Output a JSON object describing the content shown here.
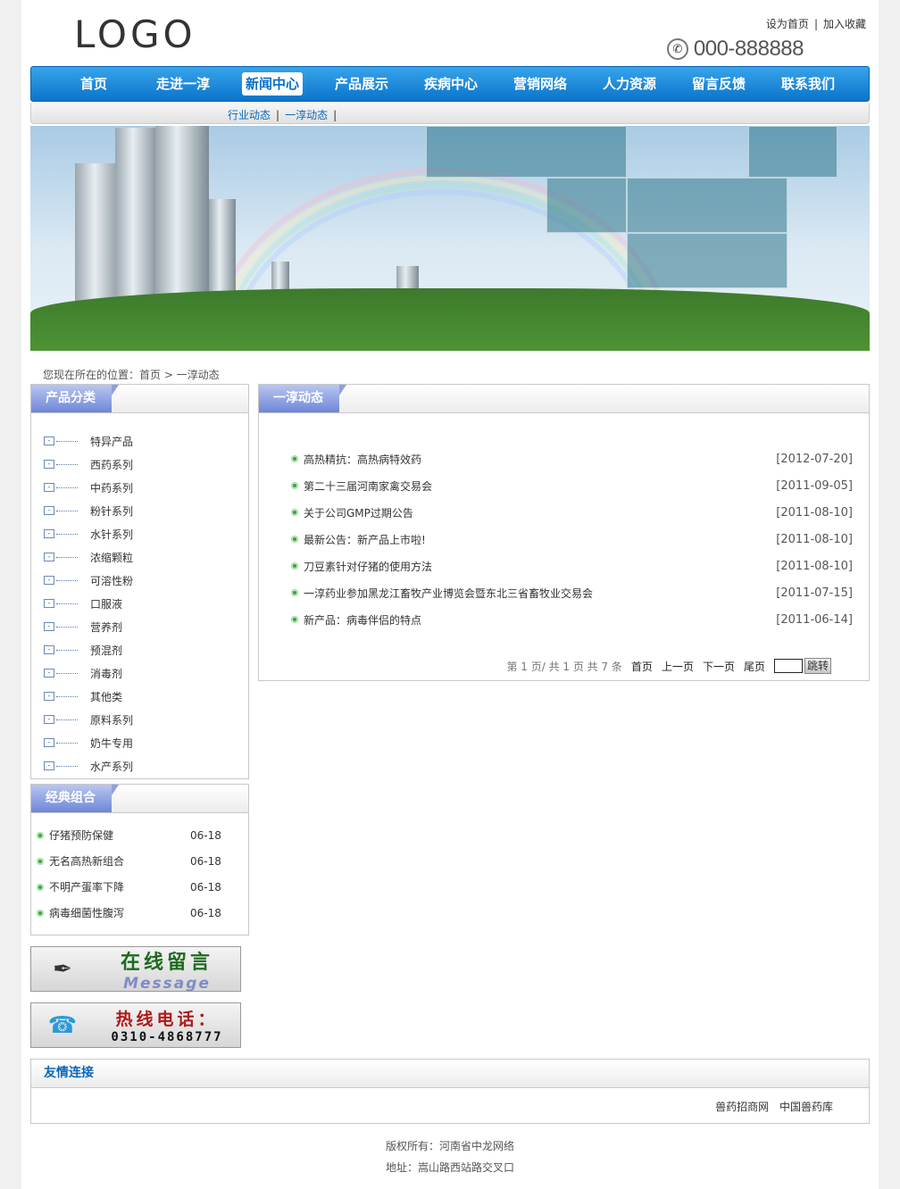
{
  "header": {
    "logo": "LOGO",
    "set_home": "设为首页",
    "sep": "|",
    "add_favorite": "加入收藏",
    "phone": "000-888888"
  },
  "nav": {
    "items": [
      "首页",
      "走进一淳",
      "新闻中心",
      "产品展示",
      "疾病中心",
      "营销网络",
      "人力资源",
      "留言反馈",
      "联系我们"
    ],
    "active_index": 2
  },
  "subnav": {
    "items": [
      "行业动态",
      "一淳动态"
    ]
  },
  "breadcrumb": "您现在所在的位置：首页 > 一淳动态",
  "categories": {
    "title": "产品分类",
    "items": [
      "特异产品",
      "西药系列",
      "中药系列",
      "粉针系列",
      "水针系列",
      "浓缩颗粒",
      "可溶性粉",
      "口服液",
      "营养剂",
      "预混剂",
      "消毒剂",
      "其他类",
      "原料系列",
      "奶牛专用",
      "水产系列"
    ]
  },
  "combos": {
    "title": "经典组合",
    "items": [
      {
        "title": "仔猪预防保健",
        "date": "06-18"
      },
      {
        "title": "无名高热新组合",
        "date": "06-18"
      },
      {
        "title": "不明产蛋率下降",
        "date": "06-18"
      },
      {
        "title": "病毒细菌性腹泻",
        "date": "06-18"
      }
    ]
  },
  "badges": {
    "message_cn": "在线留言",
    "message_en": "Message",
    "hotline_cn": "热线电话：",
    "hotline_num": "0310-4868777"
  },
  "main": {
    "title": "一淳动态",
    "news": [
      {
        "title": "高热精抗：高热病特效药",
        "date": "[2012-07-20]"
      },
      {
        "title": "第二十三届河南家禽交易会",
        "date": "[2011-09-05]"
      },
      {
        "title": "关于公司GMP过期公告",
        "date": "[2011-08-10]"
      },
      {
        "title": "最新公告：新产品上市啦!",
        "date": "[2011-08-10]"
      },
      {
        "title": "刀豆素针对仔猪的使用方法",
        "date": "[2011-08-10]"
      },
      {
        "title": "一淳药业参加黑龙江畜牧产业博览会暨东北三省畜牧业交易会",
        "date": "[2011-07-15]"
      },
      {
        "title": "新产品：病毒伴侣的特点",
        "date": "[2011-06-14]"
      }
    ],
    "pager": {
      "info": "第 1 页/ 共 1 页 共 7 条",
      "first": "首页",
      "prev": "上一页",
      "next": "下一页",
      "last": "尾页",
      "go": "跳转"
    }
  },
  "links": {
    "title": "友情连接",
    "items": [
      "兽药招商网",
      "中国兽药库"
    ]
  },
  "footer": {
    "copyright": "版权所有：河南省中龙网络",
    "address": "地址：嵩山路西站路交叉口"
  },
  "colors": {
    "nav_blue": "#0a74cc",
    "link_blue": "#0a68b8",
    "bullet_green": "#3aa53a"
  }
}
